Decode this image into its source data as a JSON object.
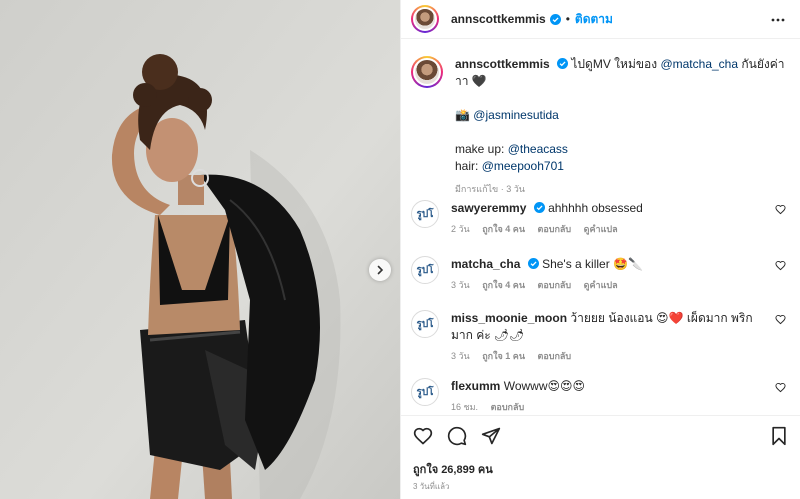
{
  "header": {
    "username": "annscottkemmis",
    "dot": "•",
    "follow_label": "ติดตาม"
  },
  "caption": {
    "username": "annscottkemmis",
    "text_prefix": "ไปดูMV ใหม่ของ ",
    "mention_main": "@matcha_cha",
    "text_suffix": " กันยังค่าาา",
    "heart": "🖤",
    "camera": "📸",
    "photo_credit": "@jasminesutida",
    "makeup_label": "make up: ",
    "makeup_handle": "@theacass",
    "hair_label": "hair: ",
    "hair_handle": "@meepooh701",
    "meta": "มีการแก้ไข · 3 วัน"
  },
  "comments": [
    {
      "avatar_text": "รูปโ",
      "username": "sawyeremmy",
      "verified": true,
      "text": "ahhhhh obsessed",
      "time": "2 วัน",
      "likes": "ถูกใจ 4 คน",
      "reply": "ตอบกลับ",
      "translate": "ดูคำแปล"
    },
    {
      "avatar_text": "รูปโ",
      "username": "matcha_cha",
      "verified": true,
      "text": "She's a killer 🤩🔪",
      "time": "3 วัน",
      "likes": "ถูกใจ 4 คน",
      "reply": "ตอบกลับ",
      "translate": "ดูคำแปล"
    },
    {
      "avatar_text": "รูปโ",
      "username": "miss_moonie_moon",
      "verified": false,
      "text": "ว้ายยย น้องแอน 😍❤️ เผ็ดมาก พริกมาก ค่ะ 🌶🌶",
      "time": "3 วัน",
      "likes": "ถูกใจ 1 คน",
      "reply": "ตอบกลับ",
      "translate": ""
    },
    {
      "avatar_text": "รูปโ",
      "username": "flexumm",
      "verified": false,
      "text": "Wowww😍😍😍",
      "time": "16 ชม.",
      "likes": "",
      "reply": "ตอบกลับ",
      "translate": ""
    }
  ],
  "actions": {
    "likes": "ถูกใจ 26,899 คน",
    "posted": "3 วันที่แล้ว"
  },
  "colors": {
    "link": "#0095f6",
    "mention": "#00376b",
    "muted": "#8e8e8e",
    "verified": "#0095f6"
  },
  "icons": [
    "more-icon",
    "verified-icon",
    "heart-icon",
    "comment-icon",
    "share-icon",
    "bookmark-icon",
    "chevron-right-icon"
  ]
}
